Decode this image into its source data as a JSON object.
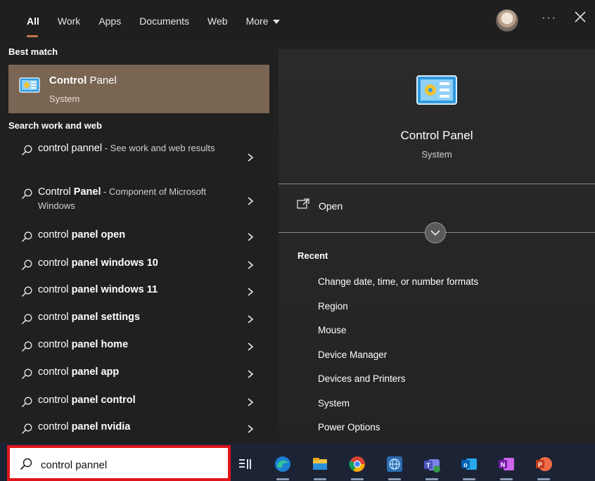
{
  "nav": {
    "tabs": [
      "All",
      "Work",
      "Apps",
      "Documents",
      "Web"
    ],
    "more_label": "More",
    "ellipsis": "···"
  },
  "left": {
    "best_match_header": "Best match",
    "best_match": {
      "title_bold": "Control",
      "title_rest": " Panel",
      "subtitle": "System"
    },
    "search_header": "Search work and web",
    "results": [
      {
        "plain": "control pannel",
        "bold": "",
        "sub": " - See work and web results"
      },
      {
        "plain": "Control ",
        "bold": "Panel",
        "sub": " - Component of Microsoft Windows"
      },
      {
        "plain": "control ",
        "bold": "panel open",
        "sub": ""
      },
      {
        "plain": "control ",
        "bold": "panel windows 10",
        "sub": ""
      },
      {
        "plain": "control ",
        "bold": "panel windows 11",
        "sub": ""
      },
      {
        "plain": "control ",
        "bold": "panel settings",
        "sub": ""
      },
      {
        "plain": "control ",
        "bold": "panel home",
        "sub": ""
      },
      {
        "plain": "control ",
        "bold": "panel app",
        "sub": ""
      },
      {
        "plain": "control ",
        "bold": "panel control",
        "sub": ""
      },
      {
        "plain": "control ",
        "bold": "panel nvidia",
        "sub": ""
      }
    ]
  },
  "right": {
    "title": "Control Panel",
    "subtitle": "System",
    "open_label": "Open",
    "recent_header": "Recent",
    "recent": [
      "Change date, time, or number formats",
      "Region",
      "Mouse",
      "Device Manager",
      "Devices and Printers",
      "System",
      "Power Options"
    ]
  },
  "taskbar": {
    "search_value": "control pannel",
    "apps": [
      "task-view",
      "edge",
      "file-explorer",
      "chrome",
      "network",
      "teams",
      "outlook",
      "onenote",
      "powerpoint"
    ]
  },
  "colors": {
    "accent": "#c5764c",
    "best_match_bg": "#7a6553",
    "highlight_border": "#e0141c"
  }
}
